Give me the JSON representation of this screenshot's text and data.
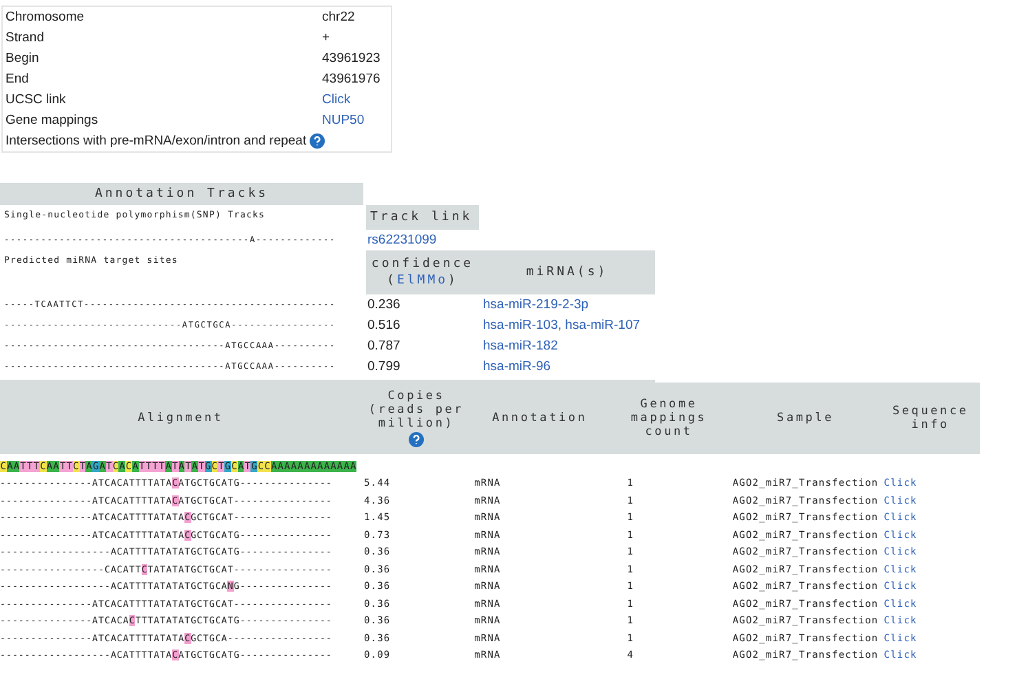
{
  "info": {
    "rows": [
      {
        "label": "Chromosome",
        "value": "chr22",
        "kind": "text"
      },
      {
        "label": "Strand",
        "value": "+",
        "kind": "text"
      },
      {
        "label": "Begin",
        "value": "43961923",
        "kind": "text"
      },
      {
        "label": "End",
        "value": "43961976",
        "kind": "text"
      },
      {
        "label": "UCSC link",
        "value": "Click",
        "kind": "link"
      },
      {
        "label": "Gene mappings",
        "value": "NUP50",
        "kind": "link"
      },
      {
        "label": "Intersections with pre-mRNA/exon/intron and repeat",
        "kind": "help"
      }
    ]
  },
  "annotation_tracks": {
    "title": "Annotation Tracks",
    "snp": {
      "label": "Single-nucleotide polymorphism(SNP) Tracks",
      "column": "Track link",
      "track": "----------------------------------------A-------------",
      "link": "rs62231099"
    },
    "targets": {
      "label": "Predicted miRNA target sites",
      "confidence_header": {
        "label": "confidence",
        "before": "(",
        "link": "ElMMo",
        "after": ")"
      },
      "mirna_header": "miRNA(s)",
      "rows": [
        {
          "track": "-----TCAATTCT-----------------------------------------",
          "confidence": "0.236",
          "mirnas": "hsa-miR-219-2-3p"
        },
        {
          "track": "-----------------------------ATGCTGCA-----------------",
          "confidence": "0.516",
          "mirnas": "hsa-miR-103, hsa-miR-107"
        },
        {
          "track": "------------------------------------ATGCCAAA----------",
          "confidence": "0.787",
          "mirnas": "hsa-miR-182"
        },
        {
          "track": "------------------------------------ATGCCAAA----------",
          "confidence": "0.799",
          "mirnas": "hsa-miR-96"
        }
      ]
    }
  },
  "alignment": {
    "columns": [
      {
        "label": "Alignment",
        "kind": "alignment",
        "help": false
      },
      {
        "label": "Copies (reads per million)",
        "kind": "copies",
        "help": true
      },
      {
        "label": "Annotation",
        "kind": "annotation",
        "help": false
      },
      {
        "label": "Genome mappings count",
        "kind": "mappings",
        "help": false
      },
      {
        "label": "Sample",
        "kind": "sample",
        "help": false
      },
      {
        "label": "Sequence info",
        "kind": "info",
        "help": false
      }
    ],
    "reference": "CAATTTCAATTCTAGATCACATTTTATATATGCTGCATGCCAAAAAAAAAAAAA",
    "rows": [
      {
        "read": [
          {
            "text": "---------------ATCACATTTTATA",
            "mismatch": false
          },
          {
            "text": "C",
            "mismatch": true
          },
          {
            "text": "ATGCTGCATG---------------",
            "mismatch": false
          }
        ],
        "copies": "5.44",
        "annotation": "mRNA",
        "mappings": "1",
        "sample": "AGO2_miR7_Transfection",
        "info": "Click"
      },
      {
        "read": [
          {
            "text": "---------------ATCACATTTTATA",
            "mismatch": false
          },
          {
            "text": "C",
            "mismatch": true
          },
          {
            "text": "ATGCTGCAT----------------",
            "mismatch": false
          }
        ],
        "copies": "4.36",
        "annotation": "mRNA",
        "mappings": "1",
        "sample": "AGO2_miR7_Transfection",
        "info": "Click"
      },
      {
        "read": [
          {
            "text": "---------------ATCACATTTTATATA",
            "mismatch": false
          },
          {
            "text": "C",
            "mismatch": true
          },
          {
            "text": "GCTGCAT----------------",
            "mismatch": false
          }
        ],
        "copies": "1.45",
        "annotation": "mRNA",
        "mappings": "1",
        "sample": "AGO2_miR7_Transfection",
        "info": "Click"
      },
      {
        "read": [
          {
            "text": "---------------ATCACATTTTATATA",
            "mismatch": false
          },
          {
            "text": "C",
            "mismatch": true
          },
          {
            "text": "GCTGCATG---------------",
            "mismatch": false
          }
        ],
        "copies": "0.73",
        "annotation": "mRNA",
        "mappings": "1",
        "sample": "AGO2_miR7_Transfection",
        "info": "Click"
      },
      {
        "read": [
          {
            "text": "------------------ACATTTTATATATGCTGCATG---------------",
            "mismatch": false
          }
        ],
        "copies": "0.36",
        "annotation": "mRNA",
        "mappings": "1",
        "sample": "AGO2_miR7_Transfection",
        "info": "Click"
      },
      {
        "read": [
          {
            "text": "-----------------CACATT",
            "mismatch": false
          },
          {
            "text": "C",
            "mismatch": true
          },
          {
            "text": "TATATATGCTGCAT----------------",
            "mismatch": false
          }
        ],
        "copies": "0.36",
        "annotation": "mRNA",
        "mappings": "1",
        "sample": "AGO2_miR7_Transfection",
        "info": "Click"
      },
      {
        "read": [
          {
            "text": "------------------ACATTTTATATATGCTGCA",
            "mismatch": false
          },
          {
            "text": "N",
            "mismatch": true
          },
          {
            "text": "G---------------",
            "mismatch": false
          }
        ],
        "copies": "0.36",
        "annotation": "mRNA",
        "mappings": "1",
        "sample": "AGO2_miR7_Transfection",
        "info": "Click"
      },
      {
        "read": [
          {
            "text": "---------------ATCACATTTTATATATGCTGCAT----------------",
            "mismatch": false
          }
        ],
        "copies": "0.36",
        "annotation": "mRNA",
        "mappings": "1",
        "sample": "AGO2_miR7_Transfection",
        "info": "Click"
      },
      {
        "read": [
          {
            "text": "---------------ATCACA",
            "mismatch": false
          },
          {
            "text": "C",
            "mismatch": true
          },
          {
            "text": "TTTATATATGCTGCATG---------------",
            "mismatch": false
          }
        ],
        "copies": "0.36",
        "annotation": "mRNA",
        "mappings": "1",
        "sample": "AGO2_miR7_Transfection",
        "info": "Click"
      },
      {
        "read": [
          {
            "text": "---------------ATCACATTTTATATA",
            "mismatch": false
          },
          {
            "text": "C",
            "mismatch": true
          },
          {
            "text": "GCTGCA-----------------",
            "mismatch": false
          }
        ],
        "copies": "0.36",
        "annotation": "mRNA",
        "mappings": "1",
        "sample": "AGO2_miR7_Transfection",
        "info": "Click"
      },
      {
        "read": [
          {
            "text": "------------------ACATTTTATA",
            "mismatch": false
          },
          {
            "text": "C",
            "mismatch": true
          },
          {
            "text": "ATGCTGCATG---------------",
            "mismatch": false
          }
        ],
        "copies": "0.09",
        "annotation": "mRNA",
        "mappings": "4",
        "sample": "AGO2_miR7_Transfection",
        "info": "Click"
      }
    ]
  }
}
